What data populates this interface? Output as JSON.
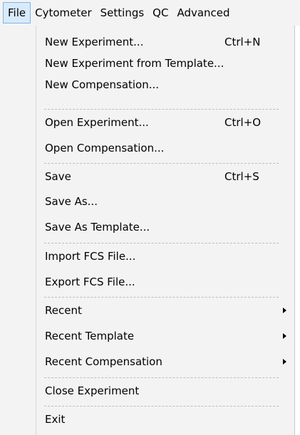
{
  "menubar": {
    "items": [
      "File",
      "Cytometer",
      "Settings",
      "QC",
      "Advanced"
    ]
  },
  "file_menu": {
    "items": [
      {
        "label": "New Experiment...",
        "shortcut": "Ctrl+N"
      },
      {
        "label": "New Experiment from Template..."
      },
      {
        "label": "New Compensation..."
      },
      {
        "label": "Open Experiment...",
        "shortcut": "Ctrl+O"
      },
      {
        "label": "Open Compensation..."
      },
      {
        "label": "Save",
        "shortcut": "Ctrl+S"
      },
      {
        "label": "Save As..."
      },
      {
        "label": "Save As Template..."
      },
      {
        "label": "Import FCS File..."
      },
      {
        "label": "Export FCS File..."
      },
      {
        "label": "Recent"
      },
      {
        "label": "Recent Template"
      },
      {
        "label": "Recent Compensation"
      },
      {
        "label": "Close Experiment"
      },
      {
        "label": "Exit"
      }
    ]
  }
}
